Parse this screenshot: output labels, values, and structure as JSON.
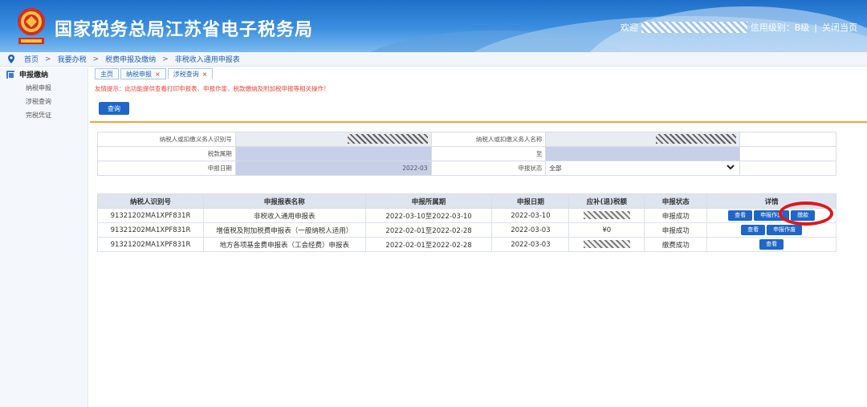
{
  "header": {
    "title": "国家税务总局江苏省电子税务局",
    "welcome_prefix": "欢迎",
    "credit_text": "信用级别：B级",
    "separator": "|",
    "close_label": "关闭当页"
  },
  "breadcrumb": {
    "items": [
      "首页",
      "我要办税",
      "税费申报及缴纳",
      "非税收入通用申报表"
    ],
    "sep": ">"
  },
  "sidebar": {
    "section": "申报缴纳",
    "items": [
      "纳税申报",
      "涉税查询",
      "完税凭证"
    ]
  },
  "tabs": [
    {
      "label": "主页",
      "close": ""
    },
    {
      "label": "纳税申报",
      "close": "×"
    },
    {
      "label": "涉税查询",
      "close": "×"
    }
  ],
  "notice": "友情提示：此功能提供查看打印申报表、申报作废、税款缴纳及附加税申报等相关操作！",
  "query_button": "查询",
  "form": {
    "taxpayer_id_label": "纳税人或扣缴义务人识别号",
    "taxpayer_name_label": "纳税人或扣缴义务人名称",
    "period_label": "税款属期",
    "to_label": "至",
    "date_label": "申报日期",
    "date_value": "2022-03",
    "status_label": "申报状态",
    "status_value": "全部"
  },
  "results": {
    "headers": [
      "纳税人识别号",
      "申报报表名称",
      "申报所属期",
      "申报日期",
      "应补(退)税额",
      "申报状态",
      "详情"
    ],
    "rows": [
      {
        "id": "91321202MA1XPF831R",
        "name": "非税收入通用申报表",
        "period": "2022-03-10至2022-03-10",
        "date": "2022-03-10",
        "amount": "",
        "status": "申报成功",
        "actions": [
          "查看",
          "申报作废",
          "缴款"
        ]
      },
      {
        "id": "91321202MA1XPF831R",
        "name": "增值税及附加税费申报表（一般纳税人适用）",
        "period": "2022-02-01至2022-02-28",
        "date": "2022-03-03",
        "amount": "¥0",
        "status": "申报成功",
        "actions": [
          "查看",
          "申报作废"
        ]
      },
      {
        "id": "91321202MA1XPF831R",
        "name": "地方各项基金费申报表（工会经费）申报表",
        "period": "2022-02-01至2022-02-28",
        "date": "2022-03-03",
        "amount": "",
        "status": "缴费成功",
        "actions": [
          "查看"
        ]
      }
    ]
  },
  "colors": {
    "header_blue": "#1f6fc9",
    "button_blue": "#1e66c9",
    "notice_red": "#e8443d",
    "accent_orange": "#f0a53a",
    "highlight_red": "#e0161b"
  }
}
